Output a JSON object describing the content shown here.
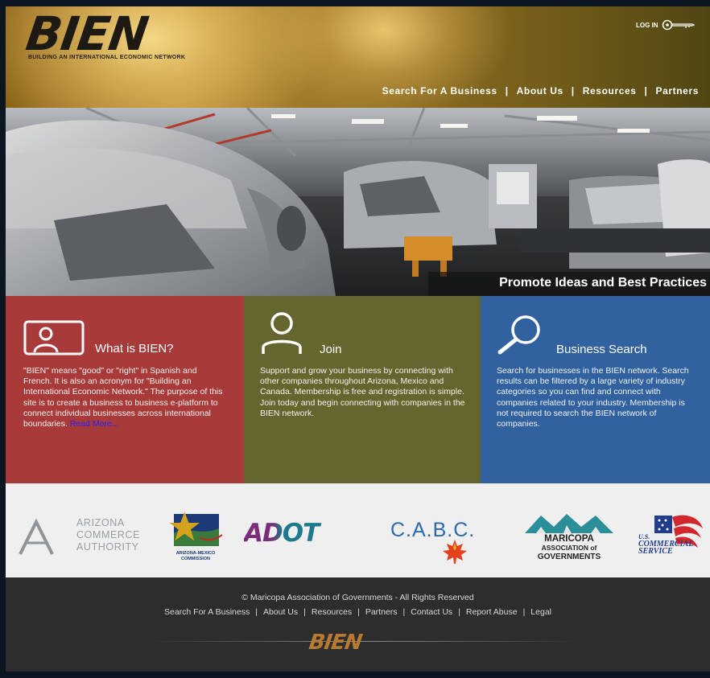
{
  "header": {
    "logo_text": "BIEN",
    "tagline": "Building an International Economic Network",
    "login_label": "LOG IN"
  },
  "nav": {
    "items": [
      "Search For A Business",
      "About Us",
      "Resources",
      "Partners"
    ],
    "separator": "|"
  },
  "hero": {
    "caption": "Promote Ideas and Best Practices"
  },
  "panels": {
    "what": {
      "title": "What is BIEN?",
      "body": "\"BIEN\" means \"good\" or \"right\" in Spanish and French. It is also an acronym for \"Building an International Economic Network.\" The purpose of this site is to create a business to business e-platform to connect individual businesses across international boundaries.",
      "link": "Read More..."
    },
    "join": {
      "title": "Join",
      "body": "Support and grow your business by connecting with other companies throughout Arizona, Mexico and Canada. Membership is free and registration is simple. Join today and begin connecting with companies in the BIEN network."
    },
    "search": {
      "title": "Business Search",
      "body": "Search for businesses in the BIEN network. Search results can be filtered by a large variety of industry categories so you can find and connect with companies related to your industry. Membership is not required to search the BIEN network of companies."
    }
  },
  "partners": {
    "aca": [
      "ARIZONA",
      "COMMERCE",
      "AUTHORITY"
    ],
    "amc": [
      "ARIZONA-MEXICO",
      "COMMISSION"
    ],
    "adot": "ADOT",
    "cabc": "C.A.B.C.",
    "mag": [
      "MARICOPA",
      "ASSOCIATION of",
      "GOVERNMENTS"
    ],
    "uscs": [
      "U.S.",
      "COMMERCIAL",
      "SERVICE"
    ]
  },
  "footer": {
    "copyright": "© Maricopa Association of Governments - All Rights Reserved",
    "links": [
      "Search For A Business",
      "About Us",
      "Resources",
      "Partners",
      "Contact Us",
      "Report Abuse",
      "Legal"
    ],
    "logo_text": "BIEN"
  },
  "colors": {
    "panel_red": "#a83a3a",
    "panel_olive": "#65652e",
    "panel_blue": "#31629f",
    "footer_bg": "#2d2d2d",
    "read_more": "#2222ff"
  }
}
